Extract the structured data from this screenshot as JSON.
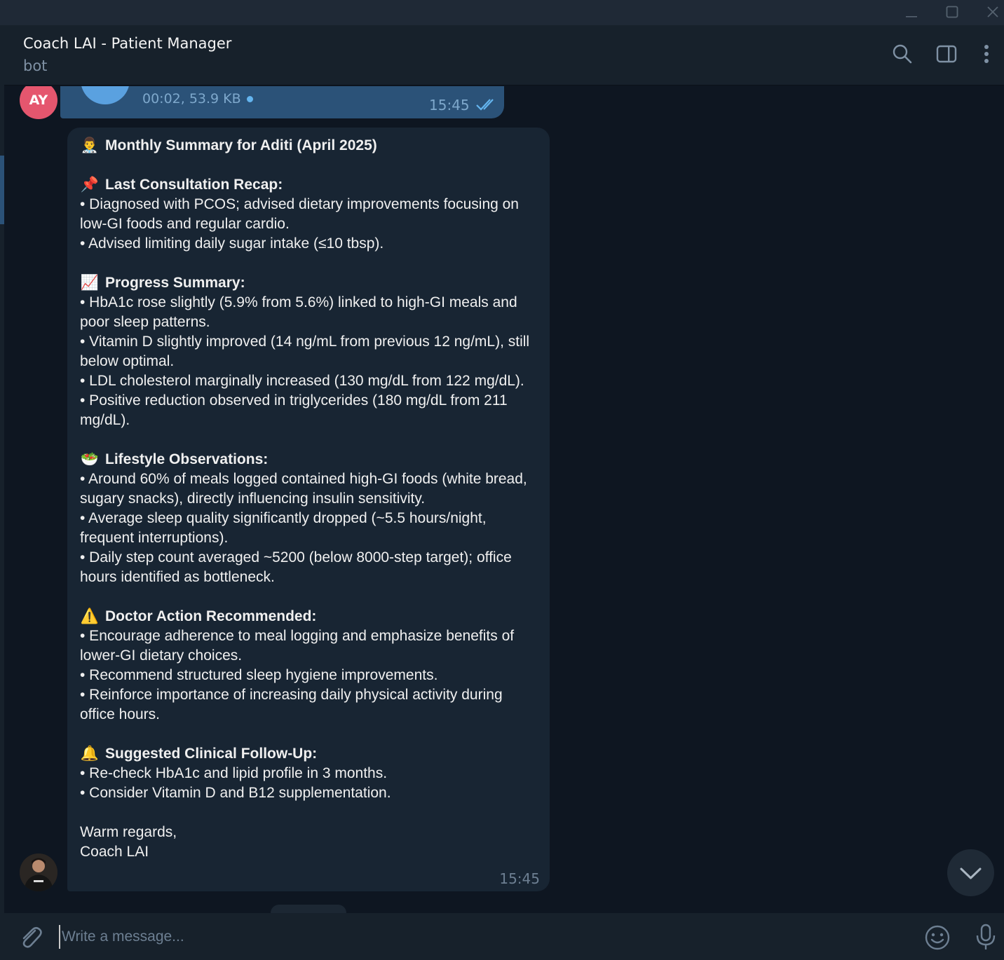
{
  "header": {
    "title": "Coach LAI - Patient Manager",
    "subtitle": "bot"
  },
  "voice_message": {
    "sender_initials": "AY",
    "meta": "00:02, 53.9 KB",
    "time": "15:45"
  },
  "summary_message": {
    "title": "Monthly Summary for Aditi (April 2025)",
    "sections": [
      {
        "heading": "Last Consultation Recap:",
        "lines": [
          "• Diagnosed with PCOS; advised dietary improvements focusing on low-GI foods and regular cardio.",
          "• Advised limiting daily sugar intake (≤10 tbsp)."
        ]
      },
      {
        "heading": "Progress Summary:",
        "lines": [
          "• HbA1c rose slightly (5.9% from 5.6%) linked to high-GI meals and poor sleep patterns.",
          "• Vitamin D slightly improved (14 ng/mL from previous 12 ng/mL), still below optimal.",
          "• LDL cholesterol marginally increased (130 mg/dL from 122 mg/dL).",
          "• Positive reduction observed in triglycerides (180 mg/dL from 211 mg/dL)."
        ]
      },
      {
        "heading": "Lifestyle Observations:",
        "lines": [
          "• Around 60% of meals logged contained high-GI foods (white bread, sugary snacks), directly influencing insulin sensitivity.",
          "• Average sleep quality significantly dropped (~5.5 hours/night, frequent interruptions).",
          "• Daily step count averaged ~5200 (below 8000-step target); office hours identified as bottleneck."
        ]
      },
      {
        "heading": "Doctor Action Recommended:",
        "lines": [
          "• Encourage adherence to meal logging and emphasize benefits of lower-GI dietary choices.",
          "• Recommend structured sleep hygiene improvements.",
          "• Reinforce importance of increasing daily physical activity during office hours."
        ]
      },
      {
        "heading": "Suggested Clinical Follow-Up:",
        "lines": [
          "• Re-check HbA1c and lipid profile in 3 months.",
          "• Consider Vitamin D and B12 supplementation."
        ]
      }
    ],
    "closing": "Warm regards,",
    "signature": "Coach LAI",
    "time": "15:45"
  },
  "composer": {
    "placeholder": "Write a message..."
  },
  "colors": {
    "accent": "#5aa1e0",
    "outgoing_bubble": "#2b5278",
    "incoming_bubble": "#182533",
    "avatar_ay": "#e5566e"
  }
}
